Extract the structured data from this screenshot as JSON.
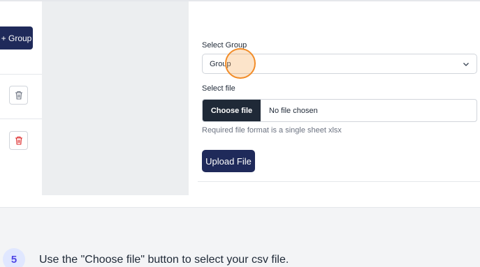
{
  "sidebar": {
    "add_group_label": "+ Group"
  },
  "modal": {
    "select_group_label": "Select Group",
    "select_group_value": "Group",
    "select_file_label": "Select file",
    "choose_file_label": "Choose file",
    "file_status": "No file chosen",
    "format_hint": "Required file format is a single sheet xlsx",
    "upload_label": "Upload File"
  },
  "icons": {
    "trash_1": "trash-icon",
    "trash_2": "trash-icon",
    "dropdown": "chevron-down-icon"
  },
  "colors": {
    "primary": "#1f2a5a",
    "choose_button": "#1f2937",
    "danger": "#dc2626",
    "cursor": "#f28c28",
    "step_accent": "#4f46e5"
  },
  "step": {
    "number": "5",
    "text": "Use the \"Choose file\" button to select your csv file."
  }
}
